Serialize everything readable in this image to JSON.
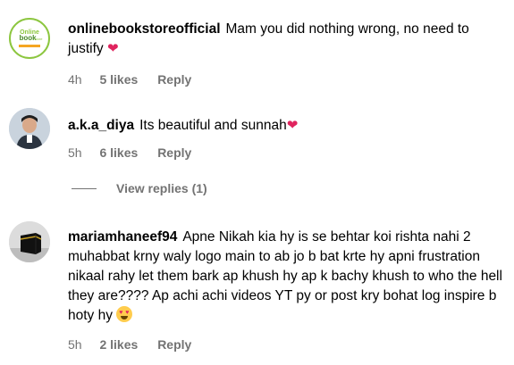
{
  "comments": [
    {
      "username": "onlinebookstoreofficial",
      "text": "Mam you did nothing wrong, no need to justify",
      "emoji": "❤",
      "time": "4h",
      "likes": "5 likes",
      "reply": "Reply",
      "avatar_text": [
        "Online",
        "book",
        "store"
      ]
    },
    {
      "username": "a.k.a_diya",
      "text": "Its beautiful and sunnah",
      "emoji": "❤",
      "time": "5h",
      "likes": "6 likes",
      "reply": "Reply"
    },
    {
      "username": "mariamhaneef94",
      "text": "Apne Nikah kia hy is se behtar koi rishta nahi 2 muhabbat krny waly logo main to ab jo b bat krte hy apni frustration nikaal rahy let them bark ap khush hy ap k bachy khush to who the hell they are???? Ap achi achi videos YT py or post kry bohat log inspire b hoty hy",
      "emoji": "heart-eyes",
      "time": "5h",
      "likes": "2 likes",
      "reply": "Reply"
    }
  ],
  "view_replies": "View replies (1)",
  "colors": {
    "meta": "#737373",
    "heart": "#e0245e",
    "avatar_green": "#8cc63f"
  }
}
